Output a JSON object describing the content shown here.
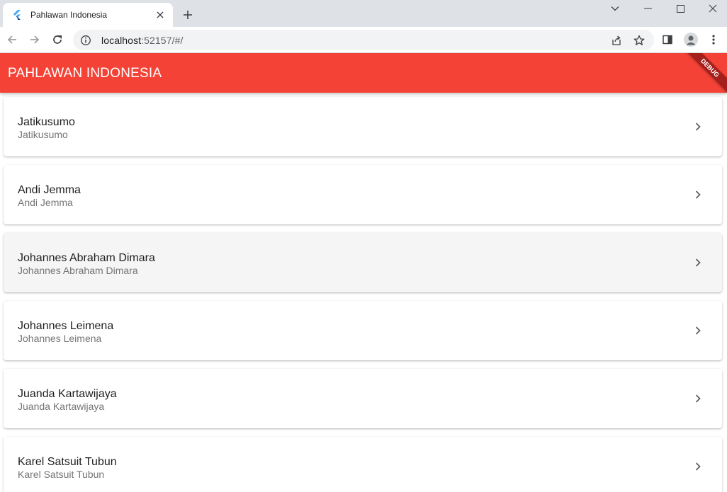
{
  "browser": {
    "tab_title": "Pahlawan Indonesia",
    "url_host": "localhost",
    "url_rest": ":52157/#/"
  },
  "app": {
    "title": "PAHLAWAN INDONESIA",
    "debug_label": "DEBUG",
    "accent_color": "#f44336"
  },
  "heroes": [
    {
      "title": "Jatikusumo",
      "subtitle": "Jatikusumo"
    },
    {
      "title": "Andi Jemma",
      "subtitle": "Andi Jemma"
    },
    {
      "title": "Johannes Abraham Dimara",
      "subtitle": "Johannes Abraham Dimara"
    },
    {
      "title": "Johannes Leimena",
      "subtitle": "Johannes Leimena"
    },
    {
      "title": "Juanda Kartawijaya",
      "subtitle": "Juanda Kartawijaya"
    },
    {
      "title": "Karel Satsuit Tubun",
      "subtitle": "Karel Satsuit Tubun"
    }
  ]
}
